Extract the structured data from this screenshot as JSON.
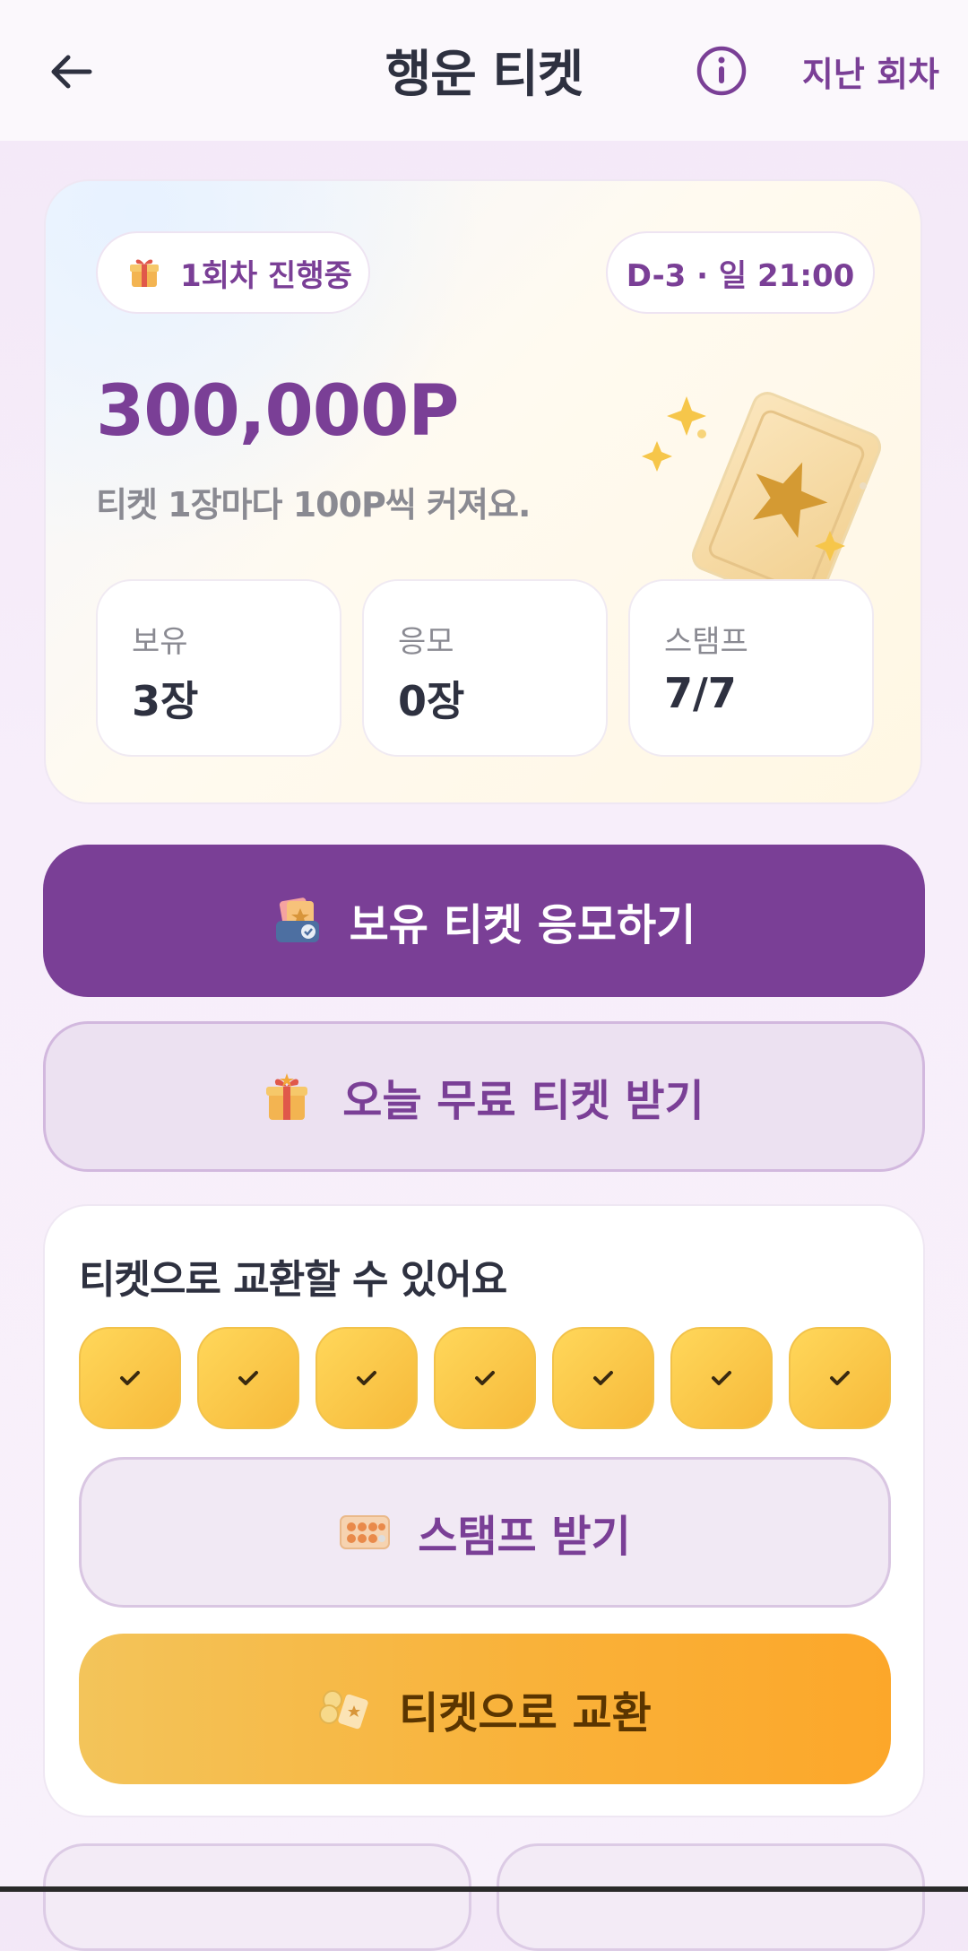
{
  "header": {
    "title": "행운 티켓",
    "past_rounds_label": "지난 회차",
    "icons": {
      "back": "back-arrow-icon",
      "info": "info-icon"
    }
  },
  "hero": {
    "round_status": "1회차 진행중",
    "deadline": "D-3 · 일 21:00",
    "prize": "300,000P",
    "prize_desc": "티켓 1장마다 100P씩 커져요.",
    "stats": [
      {
        "label": "보유",
        "value": "3장"
      },
      {
        "label": "응모",
        "value": "0장"
      },
      {
        "label": "스탬프",
        "value": "7/7"
      }
    ]
  },
  "actions": {
    "enter_label": "보유 티켓 응모하기",
    "free_label": "오늘 무료 티켓 받기"
  },
  "exchange": {
    "title": "티켓으로 교환할 수 있어요",
    "stamps_filled": 7,
    "stamps_total": 7,
    "stamp_button_label": "스탬프 받기",
    "exchange_button_label": "티켓으로 교환"
  },
  "colors": {
    "brand_purple": "#7a3f96",
    "stamp_yellow": "#ffd75a",
    "exchange_orange": "#fca72a"
  }
}
